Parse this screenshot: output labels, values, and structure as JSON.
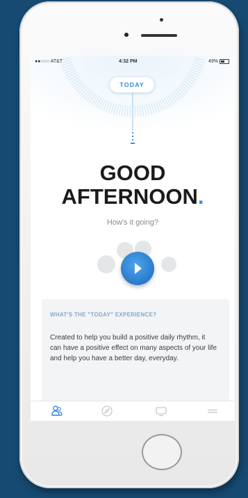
{
  "status_bar": {
    "carrier": "●●○○○ AT&T",
    "time": "4:32 PM",
    "battery": "49%"
  },
  "screen": {
    "today_label": "TODAY",
    "greeting_line1": "GOOD",
    "greeting_line2": "AFTERNOON",
    "greeting_punct": ".",
    "subtitle": "How's it going?"
  },
  "info_card": {
    "title": "WHAT'S THE \"TODAY\" EXPERIENCE?",
    "body": "Created to help you build a positive daily rhythm, it can have a positive effect on many aspects of your life and help you have a better day, everyday."
  },
  "tab_bar": {
    "tabs": [
      {
        "icon": "people-icon",
        "active": true
      },
      {
        "icon": "compass-icon",
        "active": false
      },
      {
        "icon": "screen-icon",
        "active": false
      },
      {
        "icon": "menu-icon",
        "active": false
      }
    ]
  },
  "colors": {
    "accent": "#3b8ee0",
    "background": "#164a72",
    "phone_body": "#f2f2f2"
  }
}
